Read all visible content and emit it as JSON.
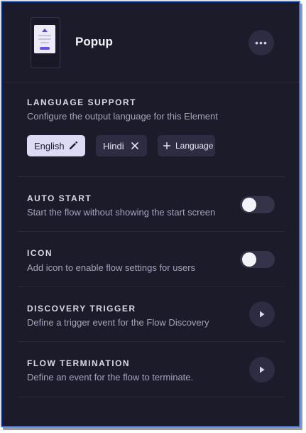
{
  "element": {
    "title": "Popup",
    "more_label": "•••"
  },
  "language_support": {
    "title": "LANGUAGE SUPPORT",
    "description": "Configure the output language for this Element",
    "languages": [
      {
        "label": "English",
        "active": true
      },
      {
        "label": "Hindi",
        "active": false
      }
    ],
    "add_label": "Language"
  },
  "auto_start": {
    "title": "AUTO START",
    "description": "Start the flow without showing the start screen",
    "enabled": false
  },
  "icon": {
    "title": "ICON",
    "description": "Add icon to enable flow settings for users",
    "enabled": false
  },
  "discovery_trigger": {
    "title": "DISCOVERY TRIGGER",
    "description": "Define a trigger event for the Flow Discovery"
  },
  "flow_termination": {
    "title": "FLOW TERMINATION",
    "description": "Define an event for the flow to terminate."
  },
  "colors": {
    "panel_bg": "#1c1b29",
    "border_accent": "#3c6fe0",
    "chip_active_bg": "#dcdaf4",
    "chip_bg": "#2d2c42",
    "thumb_accent": "#6a4ef0"
  }
}
